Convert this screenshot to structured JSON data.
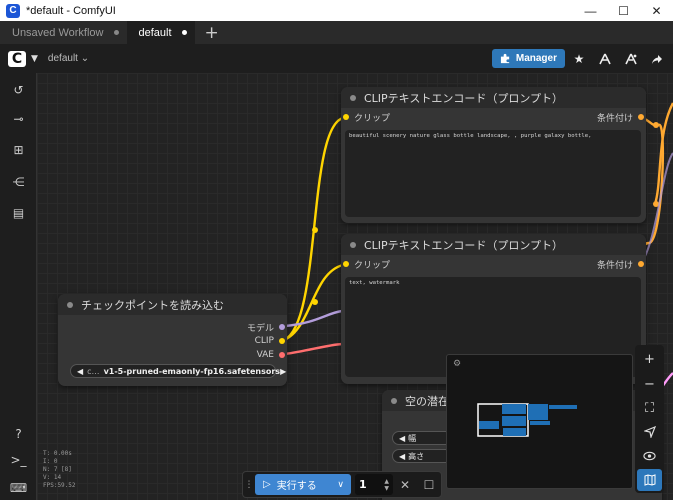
{
  "window": {
    "title": "*default - ComfyUI",
    "logo": "C",
    "minimize": "—",
    "maximize": "☐",
    "close": "✕"
  },
  "tabs": [
    {
      "label": "Unsaved Workflow"
    },
    {
      "label": "default"
    }
  ],
  "tab_add": "+",
  "menubar": {
    "workflow": "default ⌄",
    "manager_label": "Manager"
  },
  "nodes": {
    "clip1": {
      "title": "CLIPテキストエンコード（プロンプト）",
      "input": "クリップ",
      "output": "条件付け",
      "text": "beautiful scenery nature glass bottle landscape, , purple galaxy bottle,"
    },
    "clip2": {
      "title": "CLIPテキストエンコード（プロンプト）",
      "input": "クリップ",
      "output": "条件付け",
      "text": "text, watermark"
    },
    "checkpoint": {
      "title": "チェックポイントを読み込む",
      "out_model": "モデル",
      "out_clip": "CLIP",
      "out_vae": "VAE",
      "ckpt_prefix": "c…",
      "ckpt_name": "v1-5-pruned-emaonly-fp16.safetensors"
    },
    "latent": {
      "title": "空の潜在",
      "width_label": "幅",
      "height_label": "高さ"
    }
  },
  "runbar": {
    "run_label": "実行する",
    "batch": "1"
  },
  "stats": [
    "T: 0.00s",
    "I: 0",
    "N: 7 [8]",
    "V: 14",
    "FPS:59.52"
  ],
  "colors": {
    "accent": "#2e78b9",
    "clip_wire": "#ffd500",
    "model_wire": "#b39ddb",
    "vae_wire": "#ff6e6e",
    "cond_wire": "#ffa931"
  },
  "icons": {
    "sidebar": [
      "history-icon",
      "node-library-icon",
      "model-library-icon",
      "workflows-icon",
      "templates-icon",
      "help-icon",
      "terminal-icon",
      "keyboard-icon"
    ],
    "right_tools": [
      "zoom-in-icon",
      "zoom-out-icon",
      "fit-view-icon",
      "select-tool-icon",
      "link-visibility-icon",
      "minimap-icon"
    ]
  }
}
